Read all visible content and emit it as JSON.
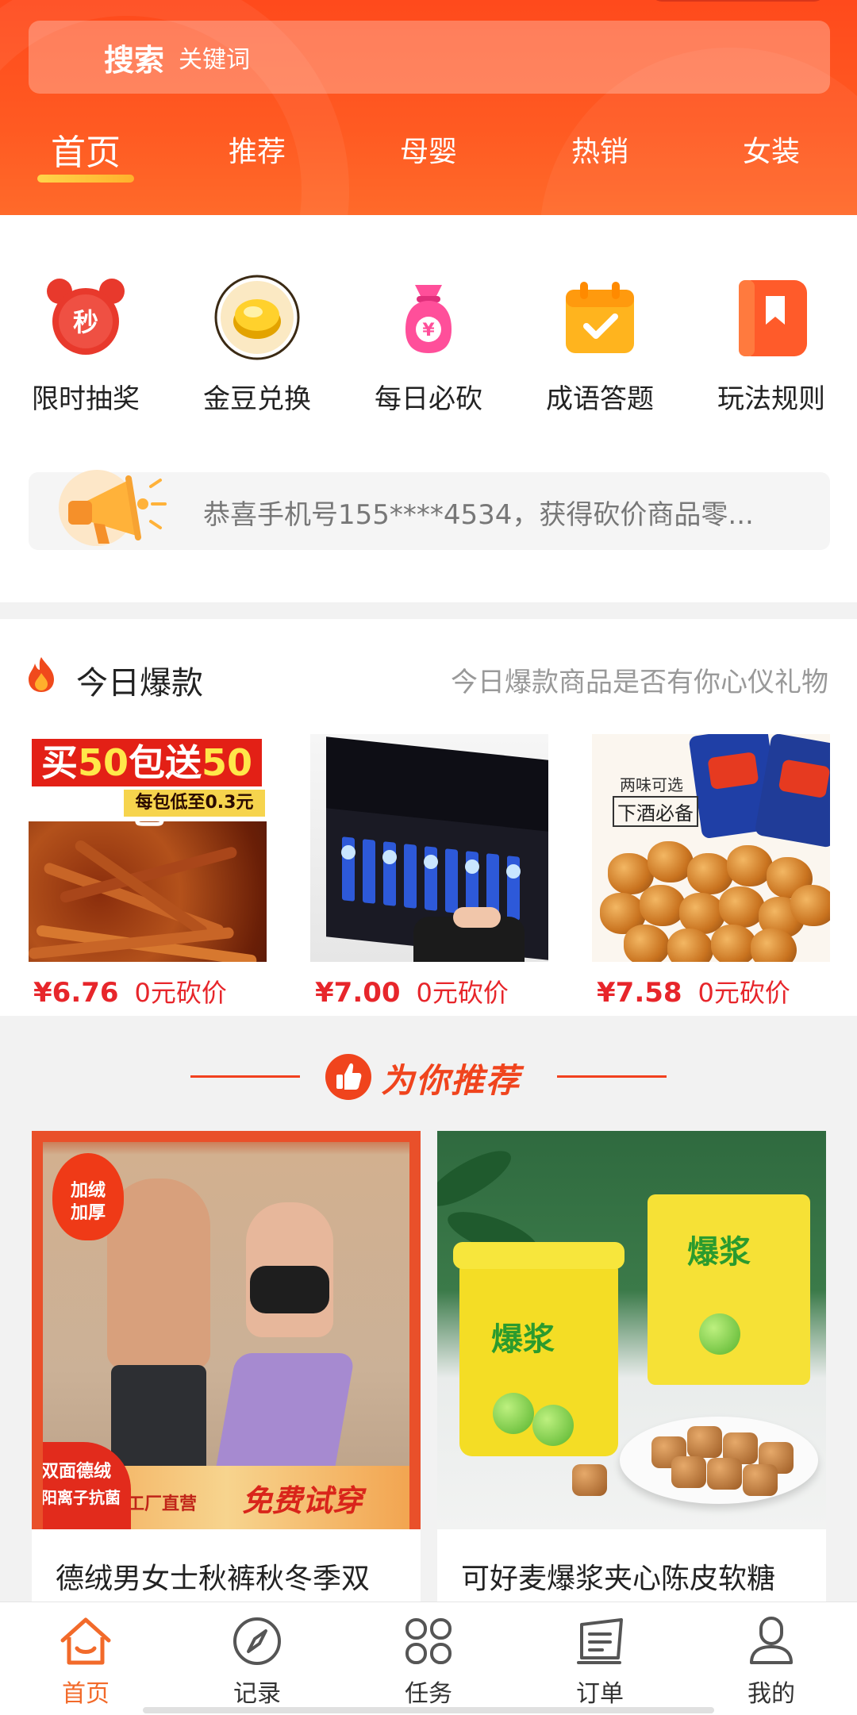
{
  "search": {
    "label": "搜索",
    "placeholder": "关键词"
  },
  "tabs": [
    {
      "label": "首页",
      "active": true
    },
    {
      "label": "推荐"
    },
    {
      "label": "母婴"
    },
    {
      "label": "热销"
    },
    {
      "label": "女装"
    }
  ],
  "categories": [
    {
      "label": "限时抽奖",
      "icon": "alarm-clock-icon",
      "glyph": "秒"
    },
    {
      "label": "金豆兑换",
      "icon": "gold-coin-icon"
    },
    {
      "label": "每日必砍",
      "icon": "money-bag-icon",
      "glyph": "¥"
    },
    {
      "label": "成语答题",
      "icon": "calendar-check-icon"
    },
    {
      "label": "玩法规则",
      "icon": "rule-book-icon"
    }
  ],
  "notice": {
    "text": "恭喜手机号155****4534，获得砍价商品零...",
    "icon": "megaphone-icon"
  },
  "hot": {
    "title": "今日爆款",
    "subtitle": "今日爆款商品是否有你心仪礼物",
    "items": [
      {
        "price": "¥6.76",
        "bargain": "0元砍价",
        "banner_main_a": "买",
        "banner_main_b": "50",
        "banner_main_c": "包送",
        "banner_main_d": "50",
        "banner_main_e": "包",
        "banner_sub": "每包低至0.3元"
      },
      {
        "price": "¥7.00",
        "bargain": "0元砍价"
      },
      {
        "price": "¥7.58",
        "bargain": "0元砍价",
        "tag_small": "两味可选",
        "tag_big": "下酒必备"
      }
    ]
  },
  "recommend": {
    "title": "为你推荐",
    "items": [
      {
        "name": "德绒男女士秋裤秋冬季双",
        "badge": "加绒\n加厚",
        "seal_line1": "双面德绒",
        "seal_line2": "阳离子抗菌",
        "ribbon_small": "工厂直营",
        "ribbon_big": "免费试穿"
      },
      {
        "name": "可好麦爆浆夹心陈皮软糖",
        "pack_text": "爆浆"
      }
    ]
  },
  "bottom_nav": [
    {
      "label": "首页",
      "icon": "home-icon",
      "active": true
    },
    {
      "label": "记录",
      "icon": "compass-icon"
    },
    {
      "label": "任务",
      "icon": "grid-icon"
    },
    {
      "label": "订单",
      "icon": "order-icon"
    },
    {
      "label": "我的",
      "icon": "profile-icon"
    }
  ],
  "colors": {
    "brand": "#ff4a1c",
    "price": "#e7262b",
    "nav_active": "#f26a2a"
  }
}
